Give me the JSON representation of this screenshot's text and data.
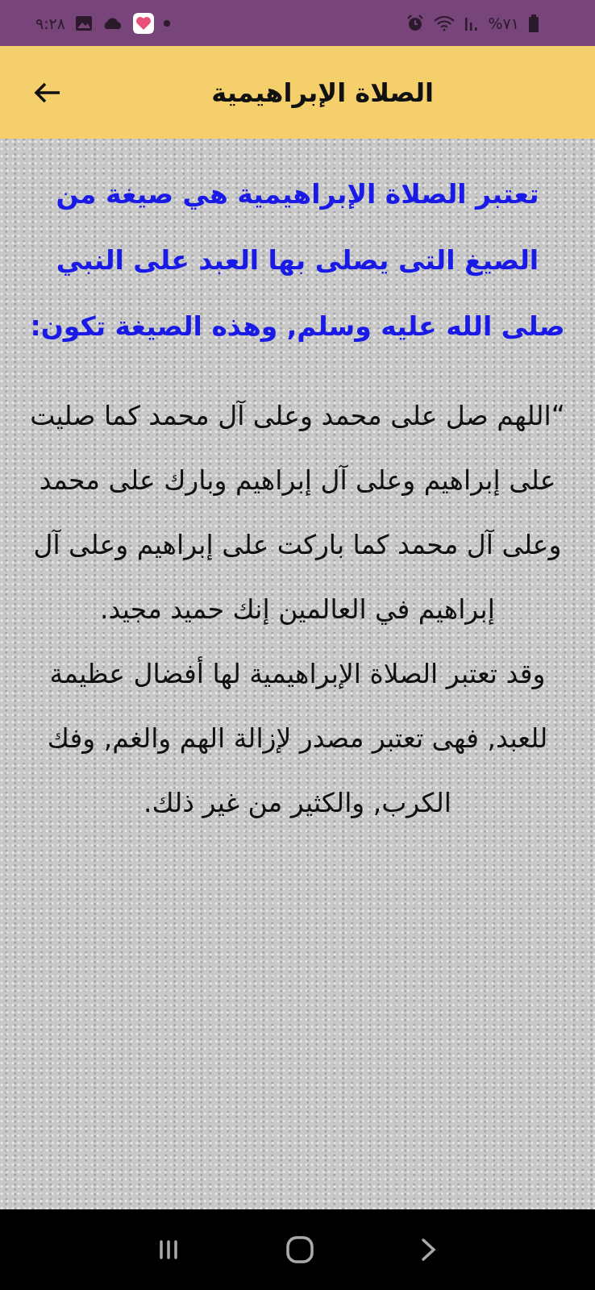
{
  "status_bar": {
    "time": "٩:٢٨",
    "battery": "%٧١"
  },
  "app_bar": {
    "title": "الصلاة الإبراهيمية"
  },
  "content": {
    "intro": "تعتبر الصلاة الإبراهيمية هي صيغة من الصيغ التى يصلى بها العبد على النبي صلى الله عليه وسلم, وهذه الصيغة تكون:",
    "paragraphs": [
      "“اللهم صل على محمد وعلى آل محمد كما صليت على إبراهيم وعلى آل إبراهيم وبارك على محمد وعلى آل محمد كما باركت على إبراهيم وعلى آل إبراهيم في العالمين إنك حميد مجيد.",
      "وقد تعتبر الصلاة الإبراهيمية لها أفضال عظيمة للعبد, فهى تعتبر مصدر لإزالة الهم والغم, وفك الكرب, والكثير من غير ذلك."
    ]
  }
}
